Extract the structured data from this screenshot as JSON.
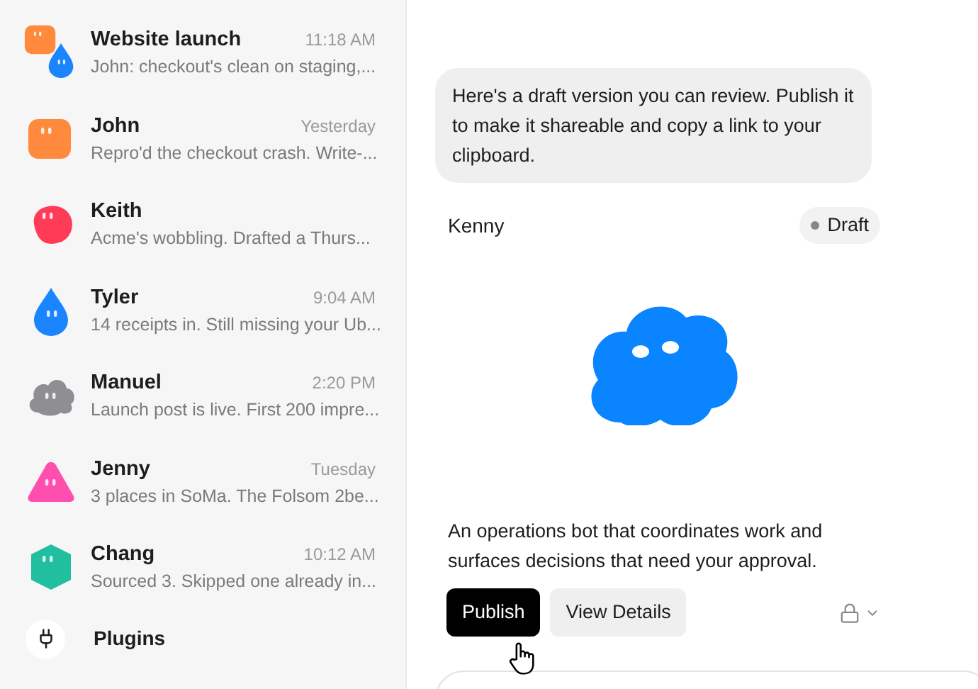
{
  "conversations": [
    {
      "name": "Website launch",
      "time": "11:18 AM",
      "preview": "John: checkout's clean on staging,...",
      "avatar": [
        {
          "kind": "square",
          "color": "#ff8a3d"
        },
        {
          "kind": "drop",
          "color": "#1a85ff"
        }
      ]
    },
    {
      "name": "John",
      "time": "Yesterday",
      "preview": "Repro'd the checkout crash. Write-...",
      "avatar": [
        {
          "kind": "square",
          "color": "#ff8a3d"
        }
      ]
    },
    {
      "name": "Keith",
      "preview": "Acme's wobbling. Drafted a Thurs...",
      "avatar": [
        {
          "kind": "blob",
          "color": "#ff3b58"
        }
      ]
    },
    {
      "name": "Tyler",
      "time": "9:04 AM",
      "preview": "14 receipts in. Still missing your Ub...",
      "avatar": [
        {
          "kind": "drop",
          "color": "#1a85ff"
        }
      ]
    },
    {
      "name": "Manuel",
      "time": "2:20 PM",
      "preview": "Launch post is live. First 200 impre...",
      "avatar": [
        {
          "kind": "cloud",
          "color": "#8e8e93"
        }
      ]
    },
    {
      "name": "Jenny",
      "time": "Tuesday",
      "preview": "3 places in SoMa. The Folsom 2be...",
      "avatar": [
        {
          "kind": "triangle",
          "color": "#ff4fae"
        }
      ]
    },
    {
      "name": "Chang",
      "time": "10:12 AM",
      "preview": "Sourced 3. Skipped one already in...",
      "avatar": [
        {
          "kind": "hexagon",
          "color": "#1fbf9f"
        }
      ]
    }
  ],
  "plugins": {
    "label": "Plugins"
  },
  "chat": {
    "message": "Here's a draft version you can review. Publish it to make it shareable and copy a link to your clipboard.",
    "agent": {
      "name": "Kenny",
      "status": "Draft",
      "avatar": {
        "kind": "cloud",
        "color": "#0a84ff"
      },
      "description": "An operations bot that coordinates work and surfaces decisions that need your approval."
    },
    "buttons": [
      {
        "label": "Publish",
        "kind": "primary"
      },
      {
        "label": "View Details",
        "kind": "secondary"
      }
    ]
  }
}
